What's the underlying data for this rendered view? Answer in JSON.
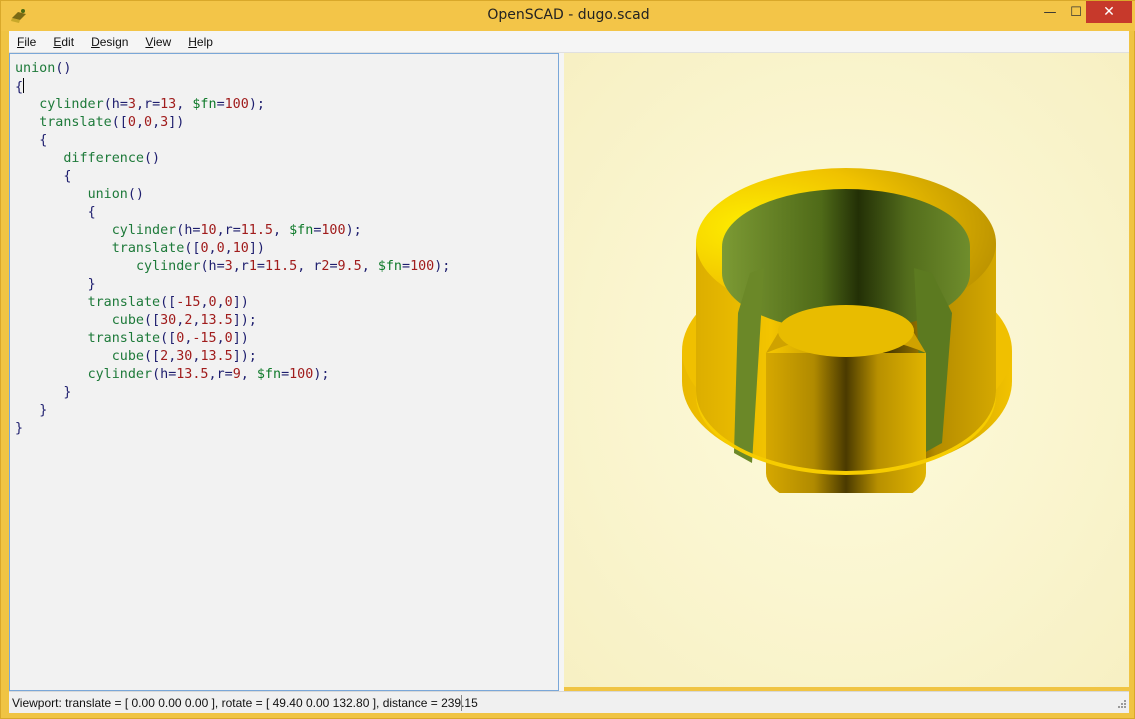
{
  "window": {
    "title": "OpenSCAD - dugo.scad",
    "controls": {
      "minimize": "—",
      "maximize": "☐",
      "close": "✕"
    }
  },
  "menu": {
    "items": [
      {
        "label": "File",
        "mnemonic": "F",
        "rest": "ile"
      },
      {
        "label": "Edit",
        "mnemonic": "E",
        "rest": "dit"
      },
      {
        "label": "Design",
        "mnemonic": "D",
        "rest": "esign"
      },
      {
        "label": "View",
        "mnemonic": "V",
        "rest": "iew"
      },
      {
        "label": "Help",
        "mnemonic": "H",
        "rest": "elp"
      }
    ]
  },
  "editor": {
    "lines": [
      "union()",
      "{",
      "   cylinder(h=3,r=13, $fn=100);",
      "   translate([0,0,3])",
      "   {",
      "      difference()",
      "      {",
      "         union()",
      "         {",
      "            cylinder(h=10,r=11.5, $fn=100);",
      "            translate([0,0,10])",
      "               cylinder(h=3,r1=11.5, r2=9.5, $fn=100);",
      "         }",
      "         translate([-15,0,0])",
      "            cube([30,2,13.5]);",
      "         translate([0,-15,0])",
      "            cube([2,30,13.5]);",
      "         cylinder(h=13.5,r=9, $fn=100);",
      "      }",
      "   }",
      "}"
    ]
  },
  "status": {
    "text": "Viewport: translate = [ 0.00 0.00 0.00 ], rotate = [ 49.40 0.00 132.80 ], distance = 239.15"
  },
  "colors": {
    "model_yellow": "#f2c200",
    "model_inner_green": "#6f8a2a",
    "viewport_bg": "#faf5cf",
    "title_bar": "#f3c548"
  }
}
